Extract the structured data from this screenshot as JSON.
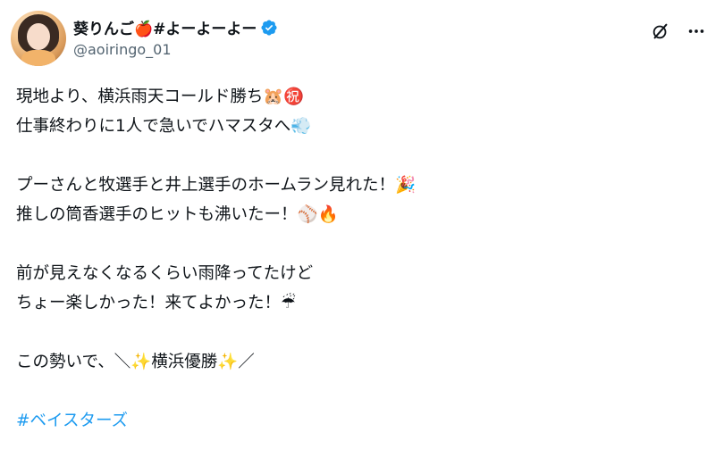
{
  "user": {
    "display_name": "葵りんご🍎#よーよーよー",
    "handle": "@aoiringo_01"
  },
  "tweet": {
    "lines": [
      "現地より、横浜雨天コールド勝ち🐹㊗️",
      "仕事終わりに1人で急いでハマスタへ💨",
      "",
      "プーさんと牧選手と井上選手のホームラン見れた！🎉",
      "推しの筒香選手のヒットも沸いたー！⚾🔥",
      "",
      "前が見えなくなるくらい雨降ってたけど",
      "ちょー楽しかった！来てよかった！☔",
      "",
      "この勢いで、＼✨横浜優勝✨／",
      ""
    ],
    "hashtag": "#ベイスターズ"
  },
  "colors": {
    "link": "#1d9bf0",
    "verified": "#1d9bf0",
    "secondary_text": "#536471"
  },
  "icons": {
    "verified": "verified-badge-icon",
    "grok": "grok-icon",
    "more": "more-icon"
  }
}
